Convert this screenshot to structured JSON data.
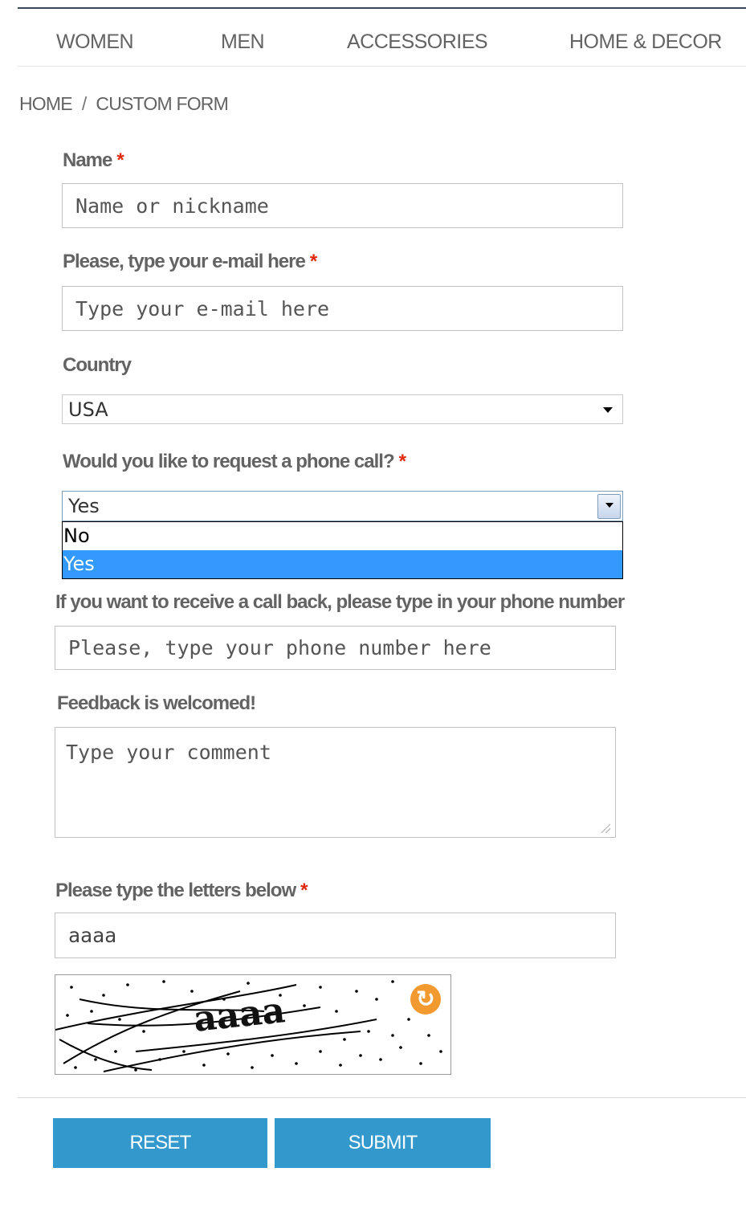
{
  "nav": {
    "items": [
      "WOMEN",
      "MEN",
      "ACCESSORIES",
      "HOME & DECOR"
    ]
  },
  "breadcrumb": {
    "home": "HOME",
    "separator": "/",
    "current": "CUSTOM FORM"
  },
  "form": {
    "required_mark": "*",
    "name": {
      "label": "Name",
      "placeholder": "Name or nickname"
    },
    "email": {
      "label": "Please, type your e-mail here",
      "placeholder": "Type your e-mail here"
    },
    "country": {
      "label": "Country",
      "value": "USA"
    },
    "phone_call": {
      "label": "Would you like to request a phone call?",
      "value": "Yes",
      "options": [
        "No",
        "Yes"
      ],
      "highlighted": "Yes"
    },
    "phone": {
      "label": "If you want to receive a call back, please type in your phone number",
      "placeholder": "Please, type your phone number here"
    },
    "feedback": {
      "label": "Feedback is welcomed!",
      "placeholder": "Type your comment"
    },
    "captcha": {
      "label": "Please type the letters below",
      "value": "aaaa",
      "image_text": "aaaa"
    }
  },
  "buttons": {
    "reset": "RESET",
    "submit": "SUBMIT"
  },
  "colors": {
    "button": "#3399cc",
    "required": "#df280a",
    "highlight": "#3399ff",
    "refresh": "#f29a30"
  },
  "icons": {
    "refresh": "refresh-icon",
    "dropdown": "chevron-down-icon",
    "resize": "resize-grip-icon"
  }
}
